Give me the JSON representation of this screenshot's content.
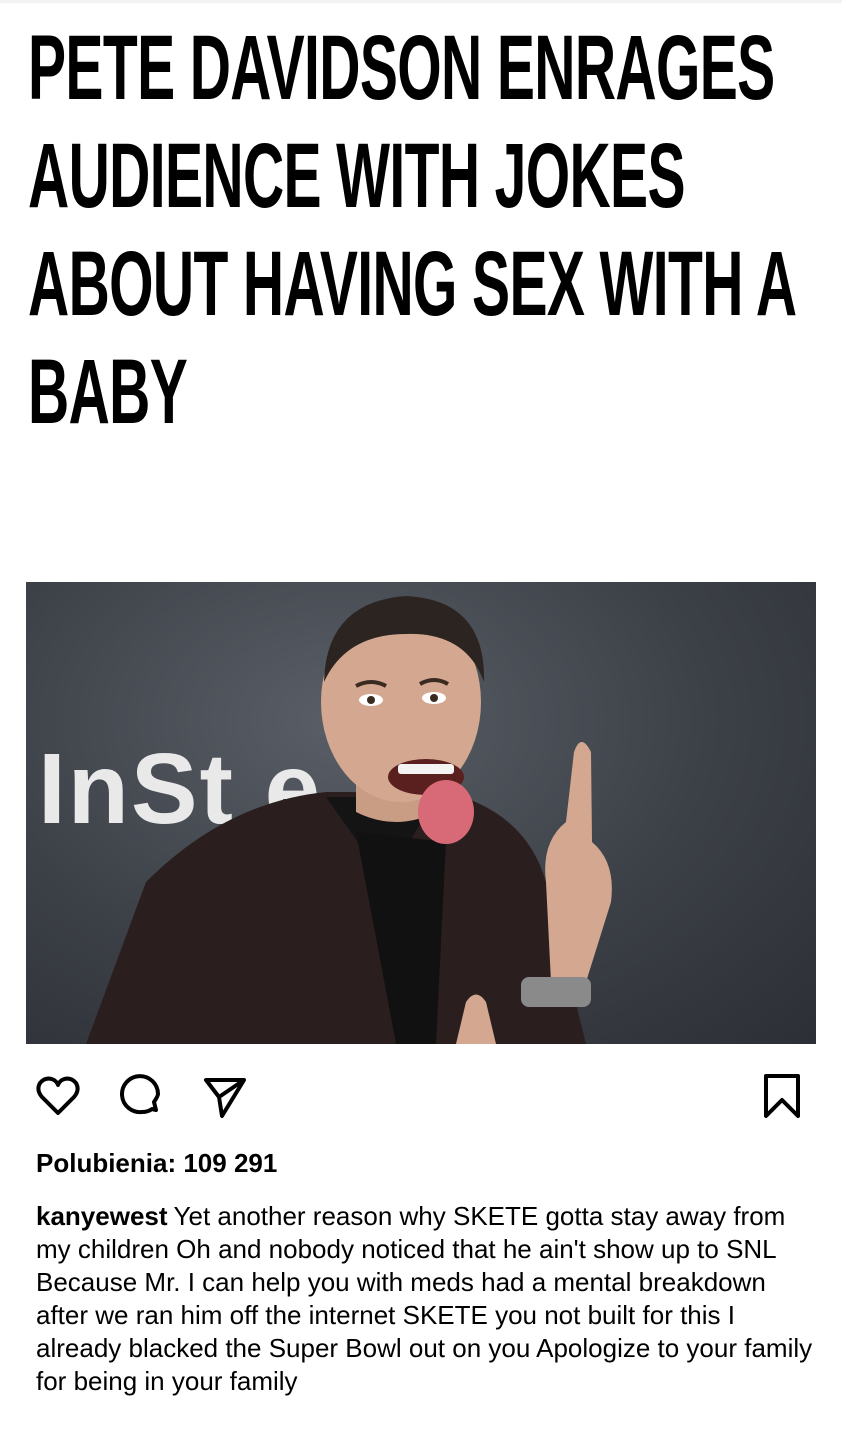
{
  "headline": "PETE DAVIDSON ENRAGES AUDIENCE WITH JOKES ABOUT HAVING SEX WITH A BABY",
  "photo": {
    "backdrop_text": "InSt  e"
  },
  "actions": {
    "like_icon": "heart-icon",
    "comment_icon": "comment-icon",
    "share_icon": "send-icon",
    "save_icon": "bookmark-icon"
  },
  "likes_text": "Polubienia: 109 291",
  "caption": {
    "username": "kanyewest",
    "text": "Yet another reason why SKETE gotta stay away from my children  Oh and nobody noticed that he ain't show up to SNL  Because Mr. I can help you with meds had a mental breakdown after we ran him off the internet  SKETE you not built for this  I already blacked the Super Bowl out on you  Apologize to your family for being in your family"
  },
  "colors": {
    "photo_background": "#3c4047",
    "text": "#000000"
  }
}
